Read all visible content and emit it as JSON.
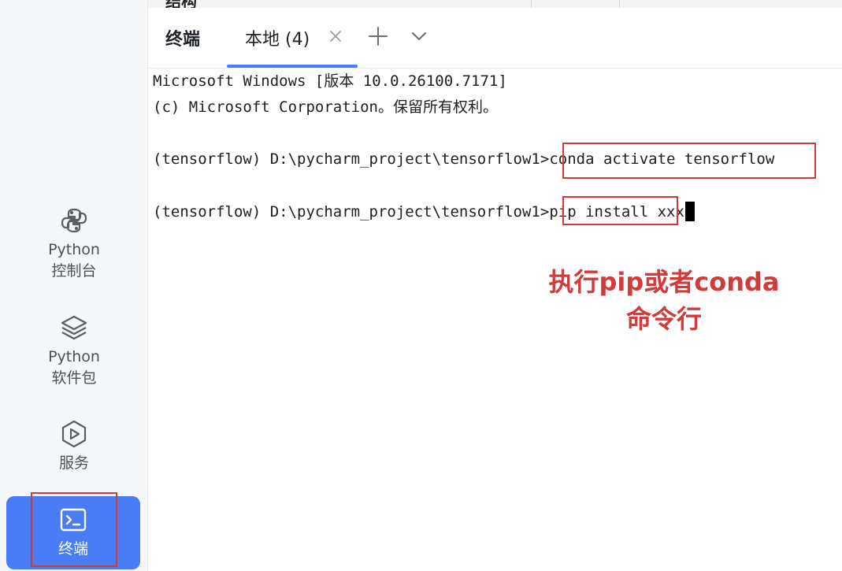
{
  "header": {
    "truncated_title": "结构"
  },
  "sidebar": {
    "items": [
      {
        "label_line1": "Python",
        "label_line2": "控制台",
        "icon": "python-icon"
      },
      {
        "label_line1": "Python",
        "label_line2": "软件包",
        "icon": "layers-icon"
      },
      {
        "label_line1": "服务",
        "label_line2": "",
        "icon": "play-hexagon-icon"
      },
      {
        "label_line1": "终端",
        "label_line2": "",
        "icon": "terminal-icon",
        "active": true
      }
    ]
  },
  "tabbar": {
    "title": "终端",
    "tabs": [
      {
        "label": "本地 (4)",
        "active": true
      }
    ],
    "add_icon": "plus-icon",
    "more_icon": "chevron-down-icon",
    "close_icon": "close-icon"
  },
  "terminal": {
    "lines": [
      "Microsoft Windows [版本 10.0.26100.7171]",
      "(c) Microsoft Corporation。保留所有权利。",
      "",
      "(tensorflow) D:\\pycharm_project\\tensorflow1>",
      "conda activate tensorflow",
      "",
      "(tensorflow) D:\\pycharm_project\\tensorflow1>",
      "pip install",
      " xxx"
    ]
  },
  "annotation": {
    "line1": "执行pip或者conda",
    "line2": "命令行",
    "color": "#d23b3b"
  },
  "colors": {
    "accent": "#4a7cf5",
    "highlight_border": "#cf3a3a"
  }
}
